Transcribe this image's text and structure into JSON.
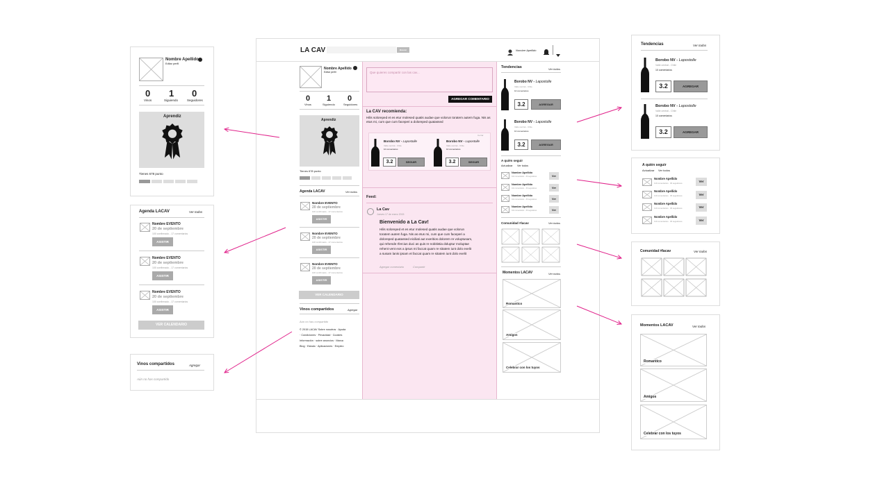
{
  "header": {
    "logo": "LA CAV",
    "search_btn": "Buscar",
    "user_name": "Nombre Apellido"
  },
  "profile": {
    "name": "Nombre Apellido",
    "edit": "Editar perfil",
    "stats": [
      {
        "n": "0",
        "l": "Vinos"
      },
      {
        "n": "1",
        "l": "Siguiendo"
      },
      {
        "n": "0",
        "l": "Seguidores"
      }
    ],
    "badge": "Aprendiz",
    "points": "Tienes 678 punto"
  },
  "agenda": {
    "title": "Agenda LACAV",
    "more": "Ver todos",
    "event": "Nombre EVENTO",
    "date": "20 de septiembre",
    "meta": "100 confirmado - 17 comentarios",
    "btn": "ASISTIR",
    "calendar": "VER CALENDARIO"
  },
  "shared": {
    "title": "Vinos compartidos",
    "add": "Agregar",
    "empty": "Aún no has compartido"
  },
  "footer": {
    "l1": "© 2015 LACAV Sobre nosotros · Ayuda",
    "l2": "· Condiciones · Privacidad · Cookies",
    "l3": "Información · sobre anuncios · Marca",
    "l4": "Blog · Estado · Aplicaciones · Empleo"
  },
  "composer": {
    "placeholder": "Que quieres compartir con las cav...",
    "btn": "AGREGAR COMENTARIO"
  },
  "recommend": {
    "title": "La CAV recomienda:",
    "text": "Hilis soloreped et es etur molesed quatis audae que volorun toratem autem fuga. Nis as etus mi, cum que cum faceperi a doloreped quatassed",
    "corner": "Cerrar",
    "wine": "Borobo NV",
    "brand": "Lapostolle",
    "origin": "Valle central - Chile",
    "comments": "10 comentarios",
    "score": "3.2",
    "btn": "SEGUIR"
  },
  "feed": {
    "label": "Feed:",
    "author": "La Cav",
    "date": "Jueves 17 de enero 2015",
    "title": "Bienvenido a La Cav!",
    "body": [
      "Hilis soloreped et es etur molesed quatis audae que volorun",
      "toratem autem fuga. Nis as etus mi, cum que cum faceperi a",
      "doloreped quatassed eiciliati aut exeritios dolorem re voluptusam,",
      "qui rehende rfercius duci as quis re nobitistia doluptur moluptae",
      "rehent vent eos a ipsus mi faccat quam re sitatem iunt dolo evelit",
      "a susam lanis ipsam et faccat quam re sitatem iunt dolo evelit"
    ],
    "like": "Agregar comentario",
    "share": "Compartir"
  },
  "trends": {
    "title": "Tendencias",
    "more": "Ver todos",
    "wine": "Borobo NV",
    "brand": "Lapostolle",
    "origin": "Valle central - Chile",
    "comments": "10 comentarios",
    "score": "3.2",
    "btn": "AGREGAR"
  },
  "follow": {
    "title": "A quién seguir",
    "refresh": "Actualizar",
    "all": "Ver todos",
    "name": "Nombre Apellido",
    "meta": "110 comentarios · 30 seguidores",
    "btn": "Ver"
  },
  "community": {
    "title": "Comunidad #lacav",
    "more": "Ver todos"
  },
  "moments": {
    "title": "Momentos LACAV",
    "more": "Ver todos",
    "items": [
      "Romantico",
      "Amigos",
      "Celebrar con los tuyos"
    ]
  },
  "colors": {
    "accent": "#e0218a",
    "pink_bg": "#fbe6f1"
  }
}
